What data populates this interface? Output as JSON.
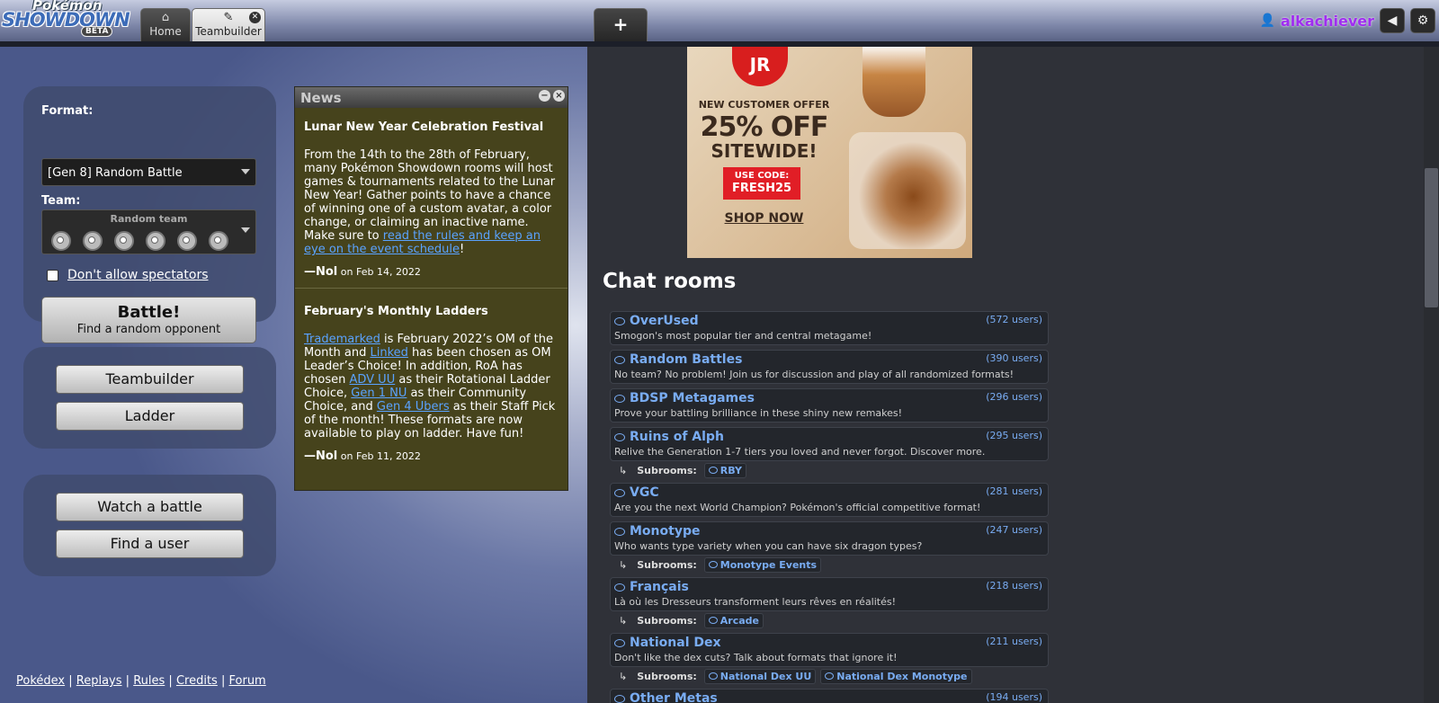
{
  "header": {
    "logo": {
      "line1": "Pokémon",
      "line2": "SHOWDOWN",
      "line3": "BETA"
    },
    "tabs": {
      "home_icon": "⌂",
      "home": "Home",
      "tb_icon": "✎",
      "teambuilder": "Teambuilder",
      "close": "✕",
      "new_tab": "+"
    },
    "user": {
      "icon": "👤",
      "name": "alkachiever",
      "sound_icon": "◀",
      "settings_icon": "⚙"
    }
  },
  "battle_box": {
    "format_label": "Format:",
    "format_value": "[Gen 8] Random Battle",
    "team_label": "Team:",
    "team_value": "Random team",
    "team_icons": [
      "pokeball-icon",
      "pokeball-icon",
      "pokeball-icon",
      "pokeball-icon",
      "pokeball-icon",
      "pokeball-icon"
    ],
    "spectators_label": "Don't allow spectators",
    "battle_title": "Battle!",
    "battle_sub": "Find a random opponent"
  },
  "nav_box": {
    "teambuilder": "Teambuilder",
    "ladder": "Ladder"
  },
  "search_box": {
    "watch": "Watch a battle",
    "find_user": "Find a user"
  },
  "footer": {
    "links": [
      "Pokédex",
      "Replays",
      "Rules",
      "Credits",
      "Forum"
    ],
    "sep": "|"
  },
  "news": {
    "title": "News",
    "min_icon": "−",
    "close_icon": "×",
    "items": [
      {
        "title": "Lunar New Year Celebration Festival",
        "body_1": "From the 14th to the 28th of February, many Pokémon Showdown rooms will host games & tournaments related to the Lunar New Year! Gather points to have a chance of winning one of a custom avatar, a color change, or claiming an inactive name. Make sure to ",
        "link": "read the rules and keep an eye on the event schedule",
        "body_2": "!",
        "author": "—Nol",
        "date": " on Feb 14, 2022"
      },
      {
        "title": "February's Monthly Ladders",
        "link_a": "Trademarked",
        "text_a": " is February 2022’s OM of the Month and ",
        "link_b": "Linked",
        "text_b": " has been chosen as OM Leader’s Choice! In addition, RoA has chosen ",
        "link_c": "ADV UU",
        "text_c": " as their Rotational Ladder Choice, ",
        "link_d": "Gen 1 NU",
        "text_d": " as their Community Choice, and ",
        "link_e": "Gen 4 Ubers",
        "text_e": " as their Staff Pick of the month! These formats are now available to play on ladder. Have fun!",
        "author": "—Nol",
        "date": " on Feb 11, 2022"
      }
    ]
  },
  "ad": {
    "logo": "JR",
    "offer": "NEW CUSTOMER OFFER",
    "pct": "25% OFF",
    "site": "SITEWIDE!",
    "code_1": "USE CODE:",
    "code_2": "FRESH25",
    "shop": "SHOP NOW"
  },
  "chat": {
    "title": "Chat rooms",
    "subrooms_label": "Subrooms:",
    "arrow": "↳",
    "rooms": [
      {
        "name": "OverUsed",
        "users": "(572 users)",
        "desc": "Smogon's most popular tier and central metagame!"
      },
      {
        "name": "Random Battles",
        "users": "(390 users)",
        "desc": "No team? No problem! Join us for discussion and play of all randomized formats!"
      },
      {
        "name": "BDSP Metagames",
        "users": "(296 users)",
        "desc": "Prove your battling brilliance in these shiny new remakes!"
      },
      {
        "name": "Ruins of Alph",
        "users": "(295 users)",
        "desc": "Relive the Generation 1-7 tiers you loved and never forgot. Discover more."
      },
      {
        "name": "VGC",
        "users": "(281 users)",
        "desc": "Are you the next World Champion? Pokémon's official competitive format!"
      },
      {
        "name": "Monotype",
        "users": "(247 users)",
        "desc": "Who wants type variety when you can have six dragon types?"
      },
      {
        "name": "Français",
        "users": "(218 users)",
        "desc": "Là où les Dresseurs transforment leurs rêves en réalités!"
      },
      {
        "name": "National Dex",
        "users": "(211 users)",
        "desc": "Don't like the dex cuts? Talk about formats that ignore it!"
      },
      {
        "name": "Other Metas",
        "users": "(194 users)",
        "desc": ""
      }
    ],
    "subrooms": {
      "ruins": [
        "RBY"
      ],
      "monotype": [
        "Monotype Events"
      ],
      "francais": [
        "Arcade"
      ],
      "natdex": [
        "National Dex UU",
        "National Dex Monotype"
      ]
    }
  }
}
